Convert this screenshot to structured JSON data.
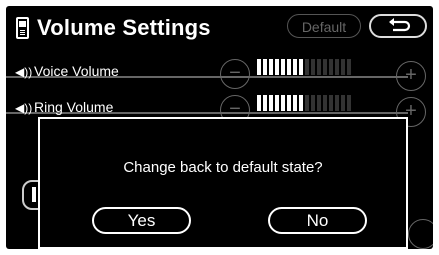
{
  "header": {
    "title": "Volume Settings",
    "default_label": "Default"
  },
  "rows": [
    {
      "label": "Voice Volume",
      "level": 8,
      "max": 16
    },
    {
      "label": "Ring Volume",
      "level": 8,
      "max": 16
    }
  ],
  "dialog": {
    "message": "Change back to default state?",
    "yes_label": "Yes",
    "no_label": "No"
  },
  "colors": {
    "background": "#000000",
    "foreground": "#ffffff",
    "disabled": "#666666"
  },
  "icons": {
    "title": "phone-icon",
    "back": "back-arrow-icon",
    "row": "speaker-icon"
  }
}
